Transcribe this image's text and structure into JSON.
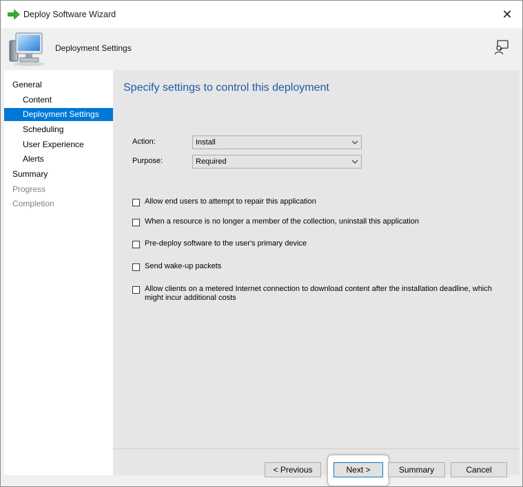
{
  "window": {
    "title": "Deploy Software Wizard",
    "close_glyph": "✕",
    "title_icon": "green-arrow-icon"
  },
  "header": {
    "title": "Deployment Settings",
    "image_icon": "computer-icon",
    "feedback_icon": "feedback-icon"
  },
  "nav": {
    "items": [
      {
        "label": "General",
        "level": 1,
        "state": "normal"
      },
      {
        "label": "Content",
        "level": 2,
        "state": "normal"
      },
      {
        "label": "Deployment Settings",
        "level": 2,
        "state": "selected"
      },
      {
        "label": "Scheduling",
        "level": 2,
        "state": "normal"
      },
      {
        "label": "User Experience",
        "level": 2,
        "state": "normal"
      },
      {
        "label": "Alerts",
        "level": 2,
        "state": "normal"
      },
      {
        "label": "Summary",
        "level": 1,
        "state": "normal"
      },
      {
        "label": "Progress",
        "level": 1,
        "state": "disabled"
      },
      {
        "label": "Completion",
        "level": 1,
        "state": "disabled"
      }
    ]
  },
  "main": {
    "heading": "Specify settings to control this deployment",
    "action": {
      "label": "Action:",
      "value": "Install"
    },
    "purpose": {
      "label": "Purpose:",
      "value": "Required"
    },
    "options": [
      {
        "label": "Allow end users to attempt to repair this application",
        "checked": false
      },
      {
        "label": "When a resource is no longer a member of the collection, uninstall this application",
        "checked": false
      },
      {
        "label": "Pre-deploy software to the user's primary device",
        "checked": false
      },
      {
        "label": "Send wake-up packets",
        "checked": false
      },
      {
        "label": "Allow clients on a metered Internet connection to download content after the installation deadline, which might incur additional costs",
        "checked": false
      }
    ]
  },
  "buttons": {
    "previous": "< Previous",
    "next": "Next >",
    "summary": "Summary",
    "cancel": "Cancel"
  },
  "colors": {
    "selection": "#0078d7",
    "heading": "#1e5aa8",
    "title_arrow": "#3aa635"
  }
}
